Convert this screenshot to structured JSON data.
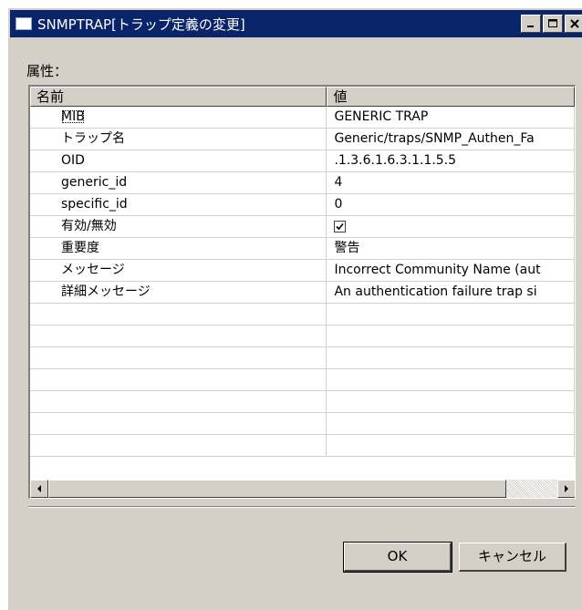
{
  "window": {
    "title": "SNMPTRAP[トラップ定義の変更]"
  },
  "attributes_label": "属性：",
  "table": {
    "columns": [
      "名前",
      "値"
    ],
    "rows": [
      {
        "name": "MIB",
        "value": "GENERIC TRAP"
      },
      {
        "name": "トラップ名",
        "value": "Generic/traps/SNMP_Authen_Fa"
      },
      {
        "name": "OID",
        "value": ".1.3.6.1.6.3.1.1.5.5"
      },
      {
        "name": "generic_id",
        "value": "4"
      },
      {
        "name": "specific_id",
        "value": "0"
      },
      {
        "name": "有効/無効",
        "value": "",
        "checked": true
      },
      {
        "name": "重要度",
        "value": "警告"
      },
      {
        "name": "メッセージ",
        "value": "Incorrect Community Name (aut"
      },
      {
        "name": "詳細メッセージ",
        "value": "An authentication failure trap si"
      }
    ],
    "empty_rows": 7
  },
  "buttons": {
    "ok": "OK",
    "cancel": "キャンセル"
  }
}
